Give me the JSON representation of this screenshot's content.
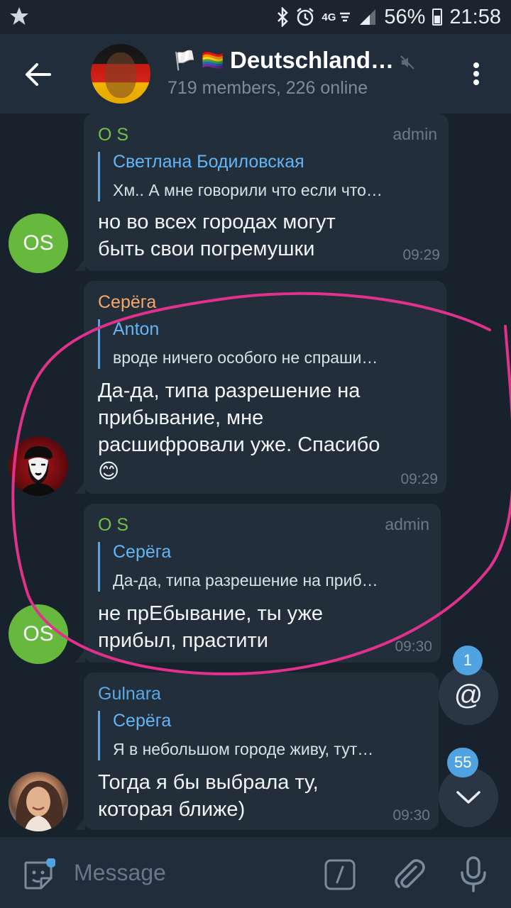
{
  "status_bar": {
    "network": "4G",
    "battery": "56%",
    "time": "21:58"
  },
  "header": {
    "title": "Deutschland…",
    "title_prefix": "🏳️ 🏳️‍🌈",
    "subtitle": "719 members, 226 online"
  },
  "messages": [
    {
      "avatar_initials": "OS",
      "sender": "O S",
      "sender_color": "#6ec24a",
      "role": "admin",
      "reply_name": "Светлана Бодиловская",
      "reply_text": "Хм.. А мне говорили что если что…",
      "text": "но во всех городах могут\nбыть свои погремушки",
      "time": "09:29"
    },
    {
      "avatar_initials": "",
      "sender": "Серёга",
      "sender_color": "#f5a86a",
      "role": "",
      "reply_name": "Anton",
      "reply_text": "вроде ничего особого не спраши…",
      "text": "Да-да, типа разрешение на\nприбывание, мне\nрасшифровали уже. Спасибо\n😊",
      "time": "09:29"
    },
    {
      "avatar_initials": "OS",
      "sender": "O S",
      "sender_color": "#6ec24a",
      "role": "admin",
      "reply_name": "Серёга",
      "reply_text": "Да-да, типа разрешение на приб…",
      "text": "не прЕбывание, ты уже\nприбыл, прастити",
      "time": "09:30"
    },
    {
      "avatar_initials": "",
      "sender": "Gulnara",
      "sender_color": "#5aa8e8",
      "role": "",
      "reply_name": "Серёга",
      "reply_text": "Я в небольшом городе живу, тут…",
      "text": "Тогда я бы выбрала ту,\nкоторая ближе)",
      "time": "09:30"
    }
  ],
  "mentions": {
    "badge": "1",
    "icon": "@"
  },
  "scroll_down": {
    "badge": "55"
  },
  "input": {
    "placeholder": "Message"
  },
  "colors": {
    "accent": "#4fa3e0",
    "annotation": "#e0318c",
    "bubble": "#222e3a",
    "background": "#18222d"
  }
}
